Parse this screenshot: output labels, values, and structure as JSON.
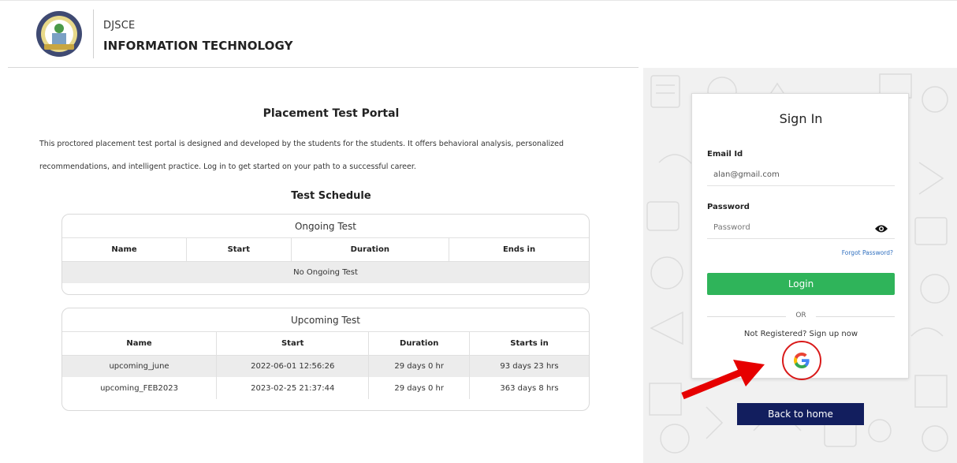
{
  "header": {
    "brand_short": "DJSCE",
    "department": "INFORMATION TECHNOLOGY"
  },
  "main": {
    "title": "Placement Test Portal",
    "intro": "This proctored placement test portal is designed and developed by the students for the students. It offers behavioral analysis, personalized recommendations, and intelligent practice. Log in to get started on your path to a successful career.",
    "schedule_title": "Test Schedule"
  },
  "ongoing": {
    "title": "Ongoing Test",
    "columns": [
      "Name",
      "Start",
      "Duration",
      "Ends in"
    ],
    "empty_text": "No Ongoing Test"
  },
  "upcoming": {
    "title": "Upcoming Test",
    "columns": [
      "Name",
      "Start",
      "Duration",
      "Starts in"
    ],
    "rows": [
      [
        "upcoming_june",
        "2022-06-01 12:56:26",
        "29 days 0 hr",
        "93 days 23 hrs"
      ],
      [
        "upcoming_FEB2023",
        "2023-02-25 21:37:44",
        "29 days 0 hr",
        "363 days 8 hrs"
      ]
    ]
  },
  "signin": {
    "title": "Sign In",
    "email_label": "Email Id",
    "email_value": "alan@gmail.com",
    "password_label": "Password",
    "password_placeholder": "Password",
    "forgot": "Forgot Password?",
    "login_label": "Login",
    "or": "OR",
    "register": "Not Registered? Sign up now",
    "back_label": "Back to home"
  },
  "colors": {
    "login_green": "#2fb45a",
    "back_navy": "#121e5e",
    "highlight_red": "#d91a1a",
    "link_blue": "#2f6fbf"
  },
  "icons": [
    "college-logo",
    "eye-icon",
    "google-icon",
    "red-arrow-annotation"
  ]
}
